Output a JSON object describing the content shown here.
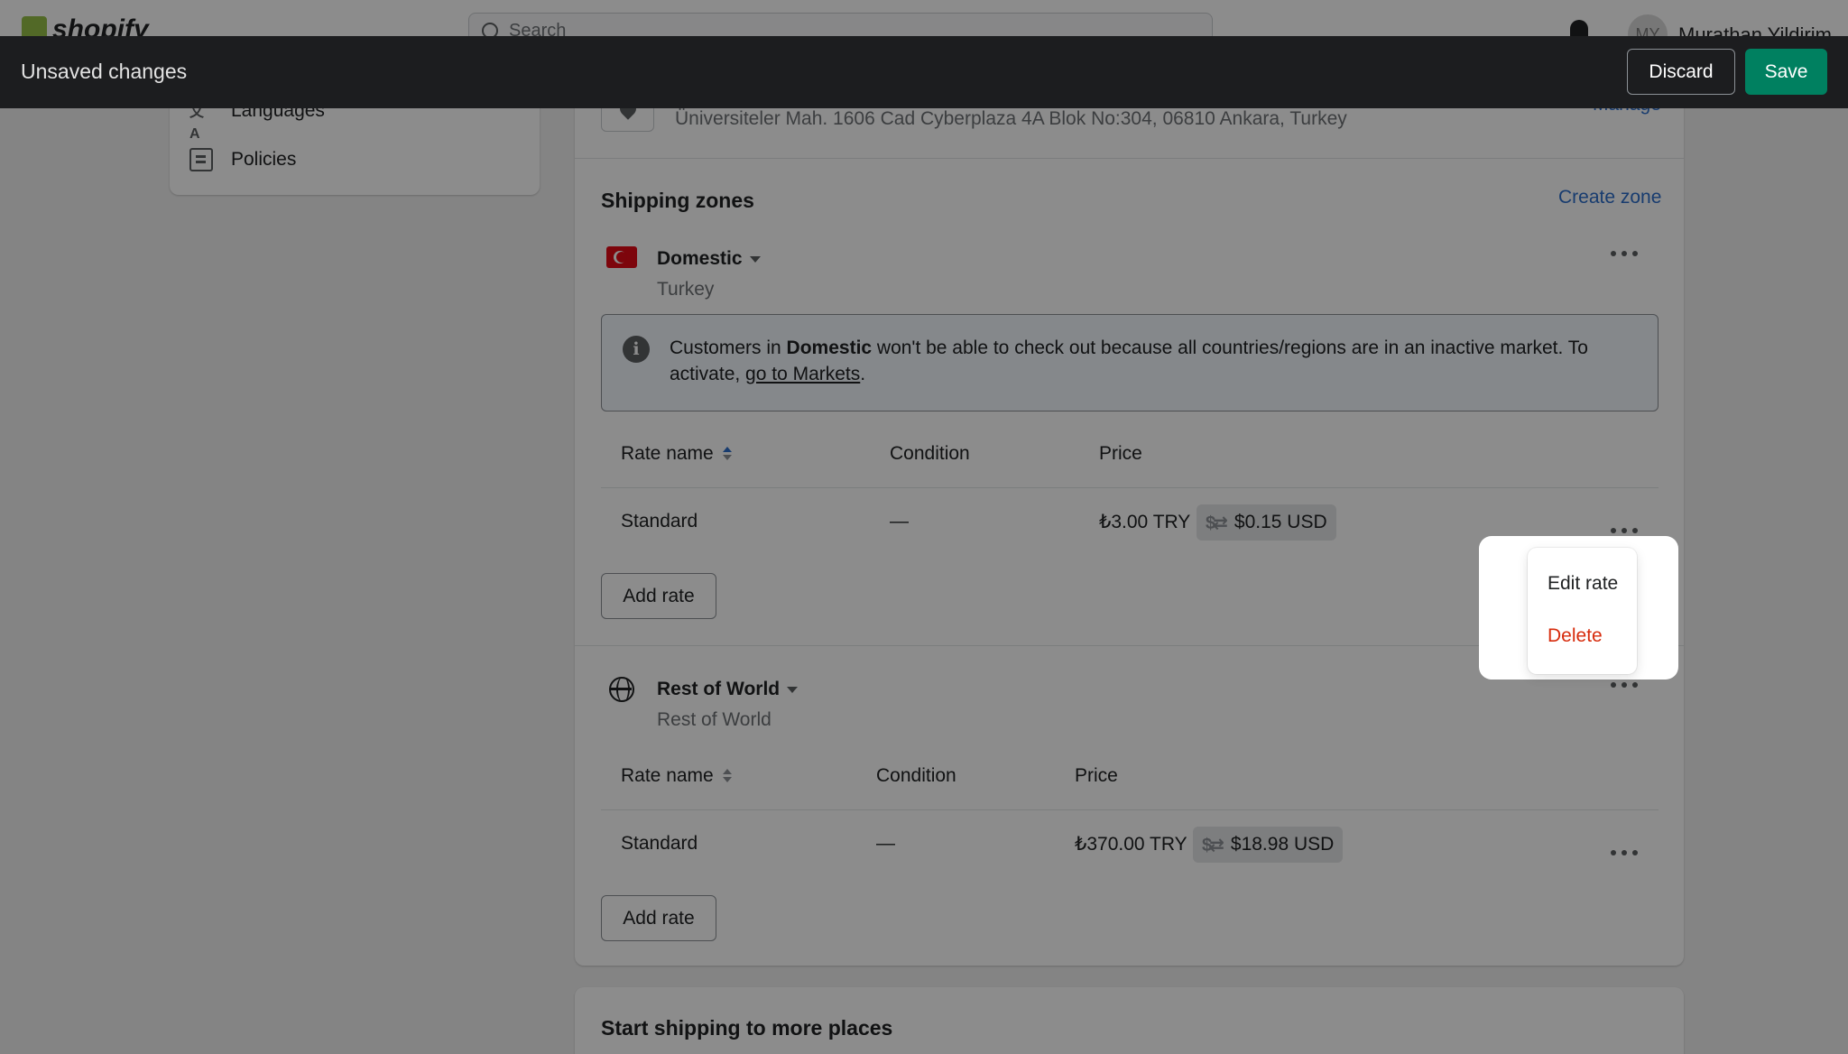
{
  "topbar": {
    "logo_text": "shopify",
    "search_placeholder": "Search",
    "avatar_initials": "MY",
    "username": "Murathan Yildirim"
  },
  "unsaved_bar": {
    "title": "Unsaved changes",
    "discard_label": "Discard",
    "save_label": "Save"
  },
  "sidebar": {
    "items": [
      {
        "label": "Languages",
        "icon": "languages-icon"
      },
      {
        "label": "Policies",
        "icon": "policies-icon"
      }
    ]
  },
  "location": {
    "address": "Üniversiteler Mah. 1606 Cad Cyberplaza 4A Blok No:304, 06810 Ankara, Turkey",
    "manage_label": "Manage"
  },
  "shipping_zones": {
    "title": "Shipping zones",
    "create_zone_label": "Create zone",
    "zones": [
      {
        "name": "Domestic",
        "countries": "Turkey",
        "banner": {
          "prefix": "Customers in ",
          "bold": "Domestic",
          "middle": " won't be able to check out because all countries/regions are in an inactive market. To activate, ",
          "link": "go to Markets",
          "suffix": "."
        },
        "headers": {
          "rate_name": "Rate name",
          "condition": "Condition",
          "price": "Price"
        },
        "rates": [
          {
            "name": "Standard",
            "condition": "—",
            "price": "₺3.00 TRY",
            "converted": "$0.15 USD"
          }
        ],
        "add_rate_label": "Add rate"
      },
      {
        "name": "Rest of World",
        "countries": "Rest of World",
        "headers": {
          "rate_name": "Rate name",
          "condition": "Condition",
          "price": "Price"
        },
        "rates": [
          {
            "name": "Standard",
            "condition": "—",
            "price": "₺370.00 TRY",
            "converted": "$18.98 USD"
          }
        ],
        "add_rate_label": "Add rate"
      }
    ]
  },
  "rate_menu": {
    "edit_label": "Edit rate",
    "delete_label": "Delete"
  },
  "more_places": {
    "title": "Start shipping to more places"
  },
  "colors": {
    "accent_link": "#2c6ecb",
    "save_green": "#008060",
    "danger": "#d72c0d"
  }
}
